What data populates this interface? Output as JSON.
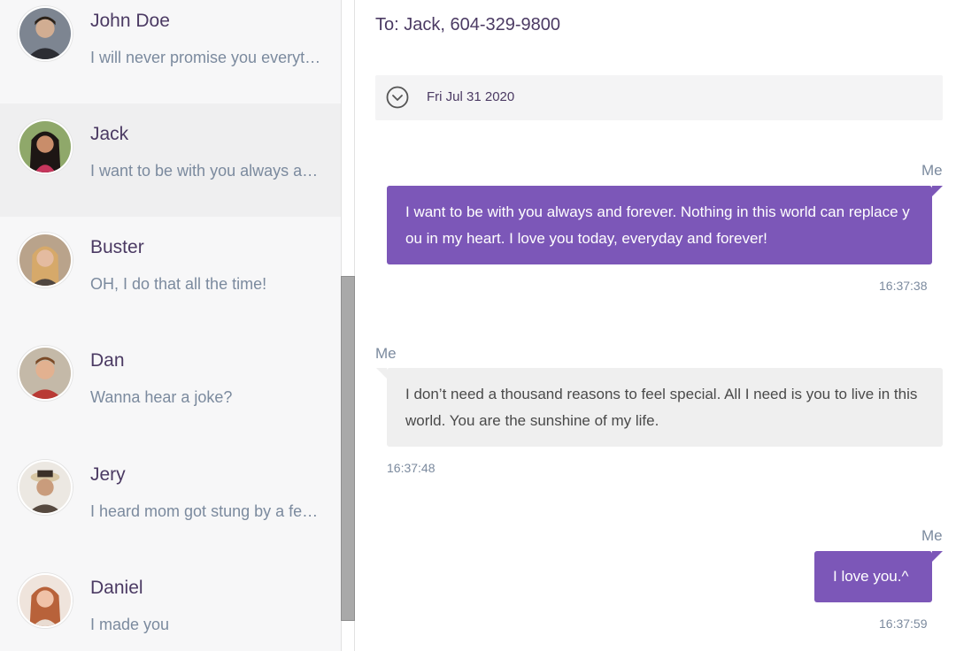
{
  "contacts": [
    {
      "name": "John Doe",
      "preview": "I will never promise you everything I can't give",
      "active": false
    },
    {
      "name": "Jack",
      "preview": "I want to be with you always and forever.",
      "active": true
    },
    {
      "name": "Buster",
      "preview": "OH, I do that all the time!",
      "active": false
    },
    {
      "name": "Dan",
      "preview": "Wanna hear a joke?",
      "active": false
    },
    {
      "name": "Jery",
      "preview": "I heard mom got stung by a few bees",
      "active": false
    },
    {
      "name": "Daniel",
      "preview": "I made you",
      "active": false
    }
  ],
  "chat": {
    "header": "To: Jack, 604-329-9800",
    "date": "Fri Jul 31 2020",
    "messages": [
      {
        "sender": "Me",
        "text": "I want to be with you always and forever. Nothing in this world can replace you in my heart. I love you today, everyday and forever!",
        "time": "16:37:38",
        "direction": "out"
      },
      {
        "sender": "Me",
        "text": "I don’t need a thousand reasons to feel special. All I need is you to live in this world. You are the sunshine of my life.",
        "time": "16:37:48",
        "direction": "in"
      },
      {
        "sender": "Me",
        "text": "I love you.^",
        "time": "16:37:59",
        "direction": "out"
      }
    ]
  },
  "colors": {
    "accent": "#7c57b8",
    "incoming_bubble": "#efefef",
    "name_text": "#4b3a63",
    "secondary_text": "#7b8a9e"
  },
  "icons": {
    "date_toggle": "chevron-down-circle-icon",
    "avatar": "avatar-photo"
  }
}
